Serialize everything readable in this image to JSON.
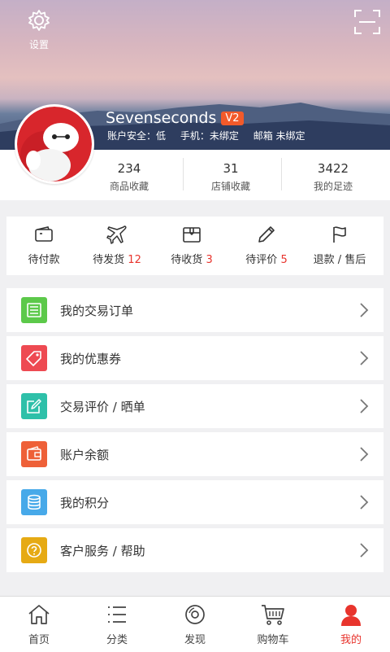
{
  "header": {
    "settings_label": "设置",
    "username": "Sevenseconds",
    "level_badge": "V2",
    "account_security": "账户安全：低",
    "phone": "手机：未绑定",
    "email": "邮箱 未绑定"
  },
  "stats": [
    {
      "value": "234",
      "label": "商品收藏"
    },
    {
      "value": "31",
      "label": "店铺收藏"
    },
    {
      "value": "3422",
      "label": "我的足迹"
    }
  ],
  "orders": [
    {
      "label": "待付款",
      "count": "",
      "icon": "wallet-icon"
    },
    {
      "label": "待发货",
      "count": "12",
      "icon": "airplane-icon"
    },
    {
      "label": "待收货",
      "count": "3",
      "icon": "package-icon"
    },
    {
      "label": "待评价",
      "count": "5",
      "icon": "pencil-icon"
    },
    {
      "label": "退款 / 售后",
      "count": "",
      "icon": "flag-icon"
    }
  ],
  "menu": [
    {
      "label": "我的交易订单",
      "icon": "order-list-icon",
      "color": "#5cc94a"
    },
    {
      "label": "我的优惠券",
      "icon": "coupon-tag-icon",
      "color": "#ee4a52"
    },
    {
      "label": "交易评价 / 晒单",
      "icon": "edit-review-icon",
      "color": "#2ec0a9"
    },
    {
      "label": "账户余额",
      "icon": "balance-wallet-icon",
      "color": "#ee6038"
    },
    {
      "label": "我的积分",
      "icon": "points-database-icon",
      "color": "#47a9e9"
    },
    {
      "label": "客户服务 / 帮助",
      "icon": "help-question-icon",
      "color": "#e6aa14"
    }
  ],
  "tabs": [
    {
      "label": "首页",
      "icon": "home-icon",
      "active": false
    },
    {
      "label": "分类",
      "icon": "category-list-icon",
      "active": false
    },
    {
      "label": "发现",
      "icon": "discover-disc-icon",
      "active": false
    },
    {
      "label": "购物车",
      "icon": "cart-icon",
      "active": false
    },
    {
      "label": "我的",
      "icon": "person-icon",
      "active": true
    }
  ],
  "colors": {
    "accent": "#e8342d",
    "background": "#f0f0f2"
  }
}
